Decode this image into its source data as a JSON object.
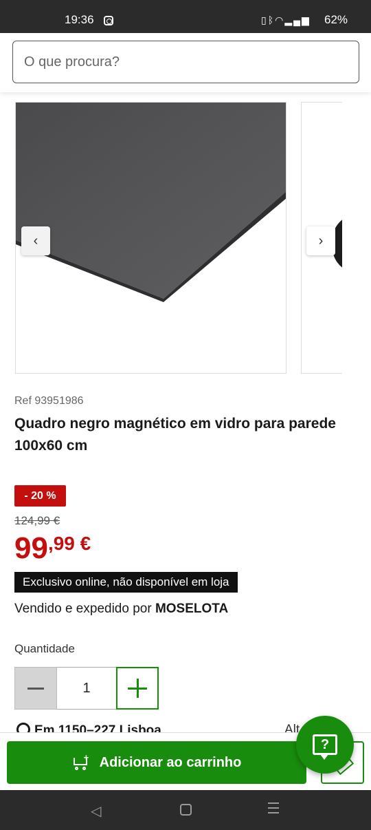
{
  "status_bar": {
    "time": "19:36",
    "battery": "62%",
    "icons": [
      "instagram-icon",
      "vibrate-icon",
      "bluetooth-icon",
      "wifi-icon",
      "signal-icon"
    ]
  },
  "search": {
    "placeholder": "O que procura?"
  },
  "gallery": {
    "prev_icon": "‹",
    "next_icon": "›"
  },
  "product": {
    "ref": "Ref 93951986",
    "title": "Quadro negro magnético em vidro para parede 100x60 cm",
    "discount": "- 20 %",
    "old_price": "124,99 €",
    "price_int": "99",
    "price_dec": ",99",
    "price_currency": " €",
    "exclusive": "Exclusivo online, não disponível em loja",
    "sold_by_prefix": "Vendido e expedido por ",
    "seller": "MOSELOTA"
  },
  "quantity": {
    "label": "Quantidade",
    "value": "1"
  },
  "store": {
    "text": "Em 1150–227 Lisboa",
    "right": "Alt"
  },
  "cart": {
    "add_label": "Adicionar ao carrinho"
  },
  "help": {
    "icon_text": "?"
  },
  "colors": {
    "accent_green": "#188c0c",
    "discount_red": "#c40f0f"
  }
}
